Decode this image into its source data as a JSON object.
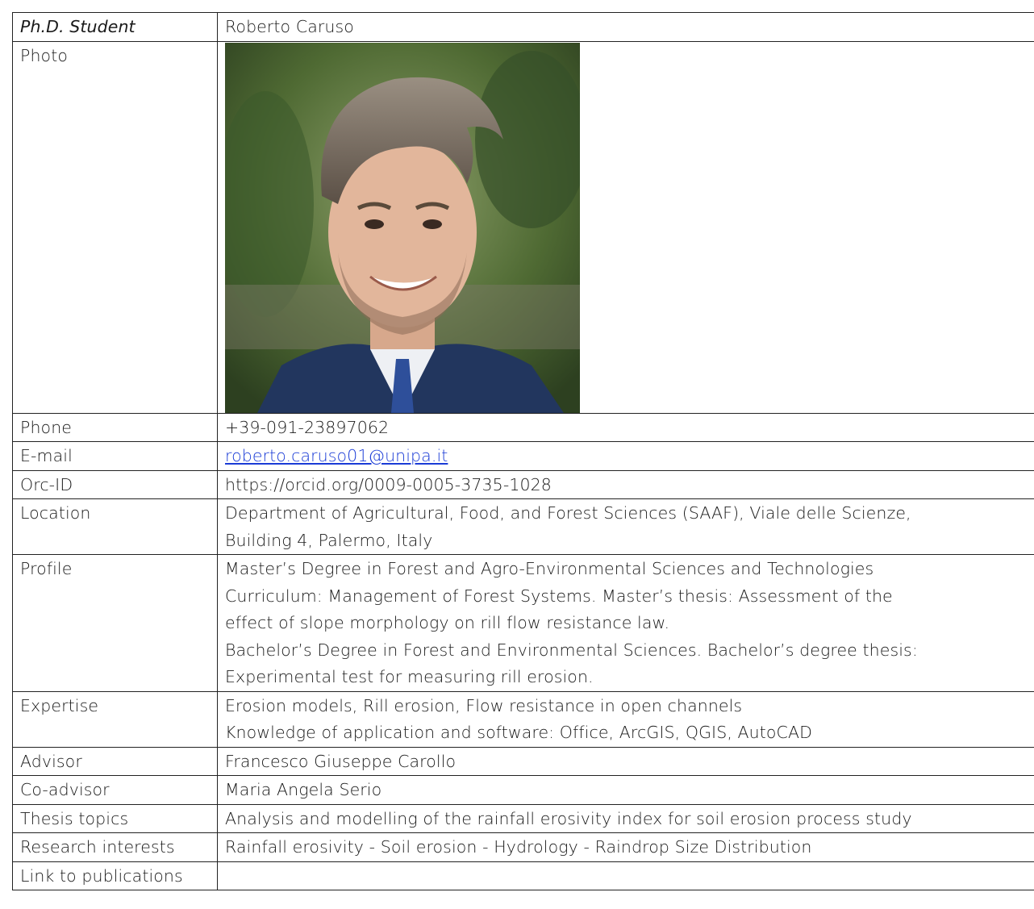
{
  "rows": {
    "student": {
      "label": "Ph.D. Student",
      "value": "Roberto Caruso"
    },
    "photo": {
      "label": "Photo",
      "image_alt": "portrait of smiling young man with swept-back hair, wearing dark blue suit, white shirt and blue tie, green foliage background"
    },
    "phone": {
      "label": "Phone",
      "value": "+39-091-23897062"
    },
    "email": {
      "label": "E-mail",
      "value": "roberto.caruso01@unipa.it"
    },
    "orcid": {
      "label": "Orc-ID",
      "value": "https://orcid.org/0009-0005-3735-1028"
    },
    "location": {
      "label": "Location",
      "lines": [
        "Department of Agricultural, Food, and Forest Sciences (SAAF), Viale delle Scienze,",
        "Building 4, Palermo, Italy"
      ]
    },
    "profile": {
      "label": "Profile",
      "lines": [
        "Master’s Degree in Forest and Agro-Environmental Sciences and Technologies",
        "Curriculum: Management of Forest Systems. Master’s thesis: Assessment of the",
        "effect of slope morphology on rill flow resistance law.",
        "Bachelor’s Degree in Forest and Environmental Sciences. Bachelor’s degree thesis:",
        "Experimental test for measuring rill erosion."
      ]
    },
    "expertise": {
      "label": "Expertise",
      "lines": [
        "Erosion models, Rill erosion, Flow resistance in open channels",
        "Knowledge of application and software: Office, ArcGIS, QGIS, AutoCAD"
      ]
    },
    "advisor": {
      "label": "Advisor",
      "value": "Francesco Giuseppe Carollo"
    },
    "coadvisor": {
      "label": "Co-advisor",
      "value": "Maria Angela Serio"
    },
    "thesis": {
      "label": "Thesis topics",
      "value": "Analysis and modelling of the rainfall erosivity index for soil erosion process study"
    },
    "research": {
      "label": "Research interests",
      "value": "Rainfall erosivity - Soil erosion - Hydrology - Raindrop Size Distribution"
    },
    "publications": {
      "label": "Link to publications",
      "value": ""
    }
  },
  "colors": {
    "link": "#1a3bd6",
    "border": "#222222",
    "text": "#1a1a1a"
  }
}
